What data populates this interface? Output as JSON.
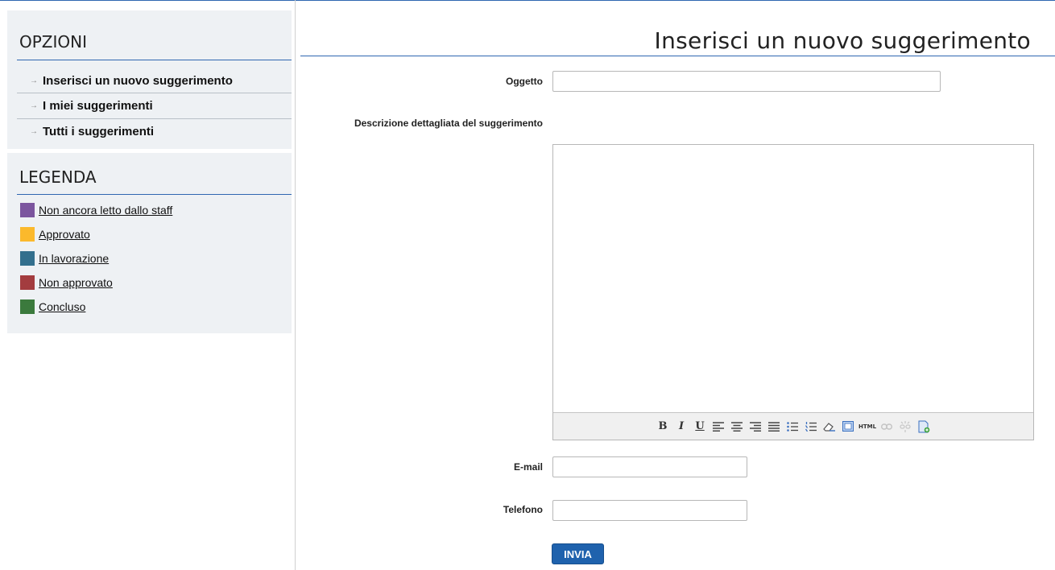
{
  "sidebar": {
    "options_title": "OPZIONI",
    "nav": [
      {
        "label": "Inserisci un nuovo suggerimento"
      },
      {
        "label": "I miei suggerimenti"
      },
      {
        "label": "Tutti i suggerimenti"
      }
    ],
    "legend_title": "LEGENDA",
    "legend": [
      {
        "label": "Non ancora letto dallo staff",
        "color": "#7b559e"
      },
      {
        "label": "Approvato",
        "color": "#fbb92c"
      },
      {
        "label": "In lavorazione",
        "color": "#336f8d"
      },
      {
        "label": "Non approvato",
        "color": "#a33c3f"
      },
      {
        "label": "Concluso",
        "color": "#3b7a3d"
      }
    ]
  },
  "main": {
    "title": "Inserisci un nuovo suggerimento",
    "form": {
      "subject_label": "Oggetto",
      "subject_value": "",
      "description_label": "Descrizione dettagliata del suggerimento",
      "description_value": "",
      "email_label": "E-mail",
      "email_value": "",
      "phone_label": "Telefono",
      "phone_value": "",
      "submit_label": "INVIA"
    },
    "toolbar": {
      "bold": "B",
      "italic": "I",
      "underline": "U",
      "html": "HTML",
      "icons": [
        "bold-icon",
        "italic-icon",
        "underline-icon",
        "align-left-icon",
        "align-center-icon",
        "align-right-icon",
        "align-justify-icon",
        "bullet-list-icon",
        "numbered-list-icon",
        "eraser-icon",
        "table-icon",
        "html-icon",
        "link-icon",
        "unlink-icon",
        "new-document-icon"
      ]
    }
  },
  "colors": {
    "accent": "#2f67b1",
    "button": "#1f62ad",
    "sidebar_bg": "#eef1f4"
  }
}
